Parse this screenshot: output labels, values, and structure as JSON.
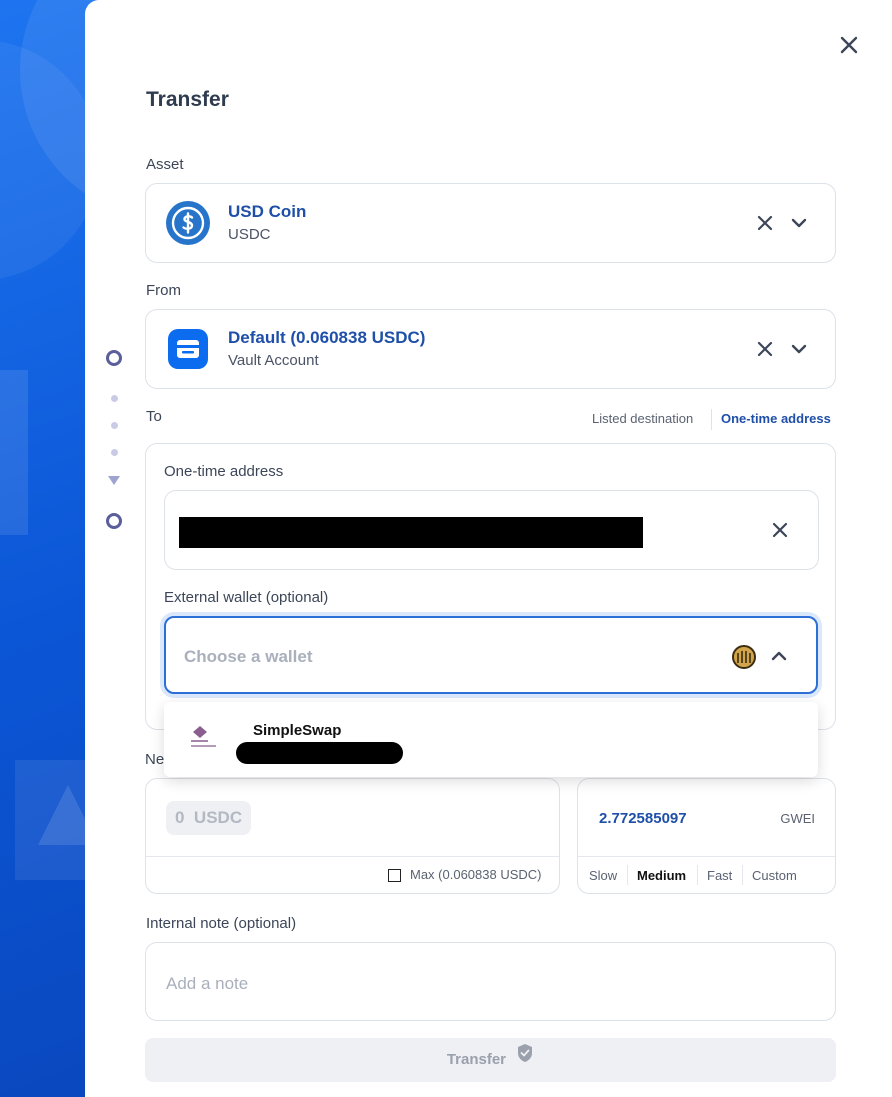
{
  "dialog": {
    "title": "Transfer",
    "close_icon": "close-icon"
  },
  "asset": {
    "label": "Asset",
    "name": "USD Coin",
    "symbol": "USDC",
    "icon": "usdc-coin-icon",
    "accent": "#2775ca"
  },
  "from": {
    "label": "From",
    "name": "Default (0.060838 USDC)",
    "type": "Vault Account",
    "icon": "vault-icon"
  },
  "to": {
    "label": "To",
    "toggle": {
      "listed": "Listed destination",
      "onetime": "One-time address",
      "selected": "One-time address"
    },
    "onetime_label": "One-time address",
    "external_wallet_label": "External wallet (optional)",
    "wallet_placeholder": "Choose a wallet",
    "dropdown": [
      {
        "name": "SimpleSwap",
        "icon": "simpleswap-icon"
      }
    ]
  },
  "network_fee_label_partial": "Ne",
  "amount": {
    "value": "0",
    "unit": "USDC",
    "max_label": "Max (0.060838 USDC)"
  },
  "gas": {
    "value": "2.772585097",
    "unit": "GWEI",
    "speeds": [
      "Slow",
      "Medium",
      "Fast",
      "Custom"
    ],
    "selected": "Medium"
  },
  "note": {
    "label": "Internal note (optional)",
    "placeholder": "Add a note"
  },
  "submit": {
    "label": "Transfer",
    "icon": "shield-check-icon"
  },
  "colors": {
    "primary_text": "#1f4fa8",
    "focus_border": "#2c6fd6",
    "background": "#1565d8"
  }
}
